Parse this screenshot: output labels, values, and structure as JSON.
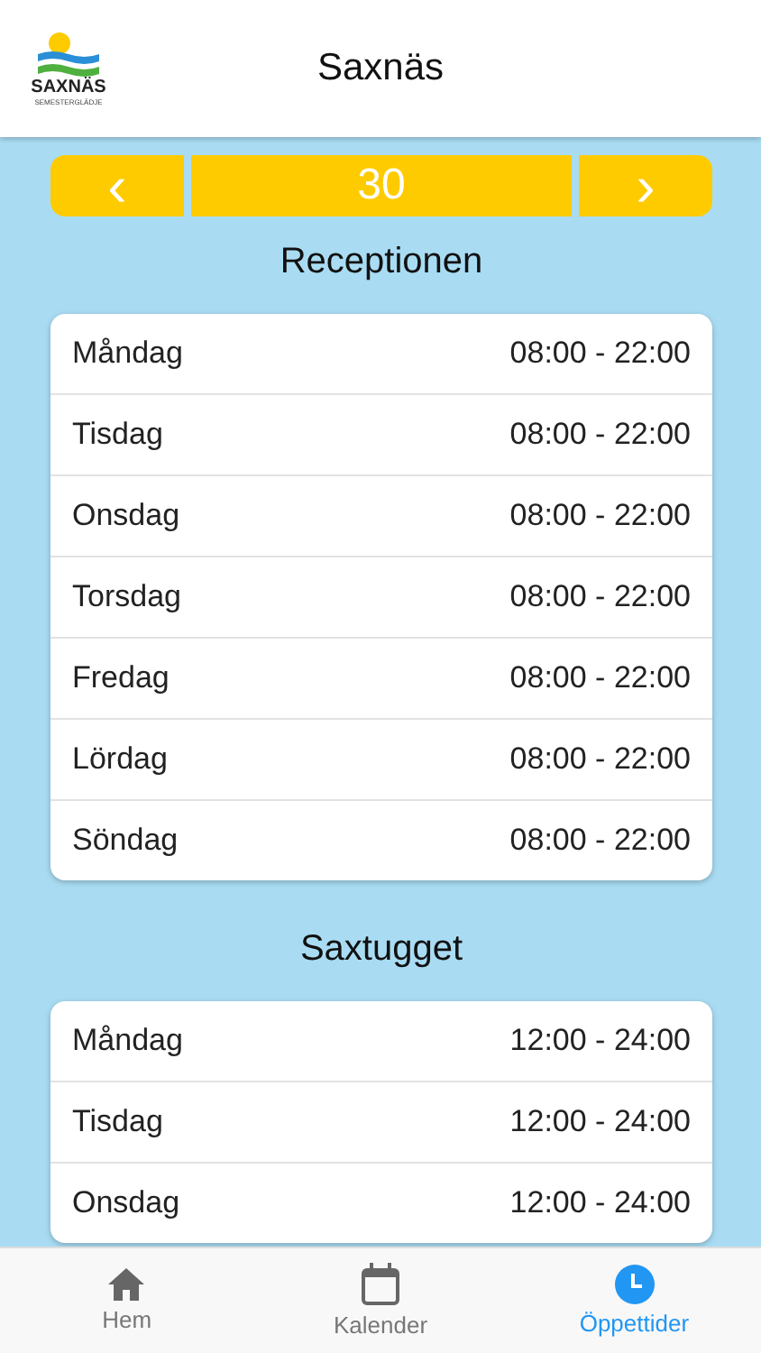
{
  "header": {
    "logo_name": "SAXNÄS",
    "logo_tagline": "SEMESTERGLÄDJE",
    "title": "Saxnäs"
  },
  "stepper": {
    "prev": "‹",
    "value": "30",
    "next": "›"
  },
  "sections": [
    {
      "title": "Receptionen",
      "rows": [
        {
          "day": "Måndag",
          "hours": "08:00 - 22:00"
        },
        {
          "day": "Tisdag",
          "hours": "08:00 - 22:00"
        },
        {
          "day": "Onsdag",
          "hours": "08:00 - 22:00"
        },
        {
          "day": "Torsdag",
          "hours": "08:00 - 22:00"
        },
        {
          "day": "Fredag",
          "hours": "08:00 - 22:00"
        },
        {
          "day": "Lördag",
          "hours": "08:00 - 22:00"
        },
        {
          "day": "Söndag",
          "hours": "08:00 - 22:00"
        }
      ]
    },
    {
      "title": "Saxtugget",
      "rows": [
        {
          "day": "Måndag",
          "hours": "12:00 - 24:00"
        },
        {
          "day": "Tisdag",
          "hours": "12:00 - 24:00"
        },
        {
          "day": "Onsdag",
          "hours": "12:00 - 24:00"
        }
      ]
    }
  ],
  "tabs": [
    {
      "kind": "home",
      "label": "Hem",
      "selected": false
    },
    {
      "kind": "calendar",
      "label": "Kalender",
      "selected": false
    },
    {
      "kind": "clock",
      "label": "Öppettider",
      "selected": true
    }
  ]
}
